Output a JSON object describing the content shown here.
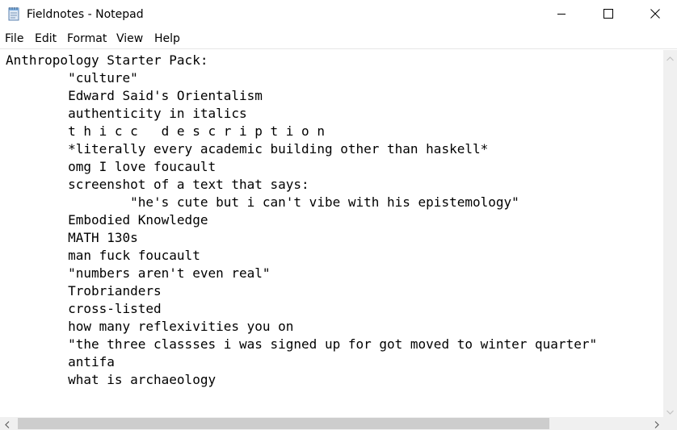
{
  "window": {
    "title": "Fieldnotes - Notepad",
    "app_icon": "notepad-icon",
    "controls": [
      "minimize-icon",
      "maximize-icon",
      "close-icon"
    ]
  },
  "menu": {
    "file": "File",
    "edit": "Edit",
    "format": "Format",
    "view": "View",
    "help": "Help"
  },
  "document": {
    "lines": [
      "Anthropology Starter Pack:",
      "        \"culture\"",
      "        Edward Said's Orientalism",
      "        authenticity in italics",
      "        t h i c c   d e s c r i p t i o n",
      "        *literally every academic building other than haskell*",
      "        omg I love foucault",
      "        screenshot of a text that says:",
      "                \"he's cute but i can't vibe with his epistemology\"",
      "        Embodied Knowledge",
      "        MATH 130s",
      "        man fuck foucault",
      "        \"numbers aren't even real\"",
      "        Trobrianders",
      "        cross-listed",
      "        how many reflexivities you on",
      "        \"the three classses i was signed up for got moved to winter quarter\"",
      "        antifa",
      "        what is archaeology"
    ]
  },
  "scrollbars": {
    "vertical_icons": [
      "chevron-up-icon",
      "chevron-down-icon"
    ],
    "horizontal_icons": [
      "chevron-left-icon",
      "chevron-right-icon"
    ]
  }
}
